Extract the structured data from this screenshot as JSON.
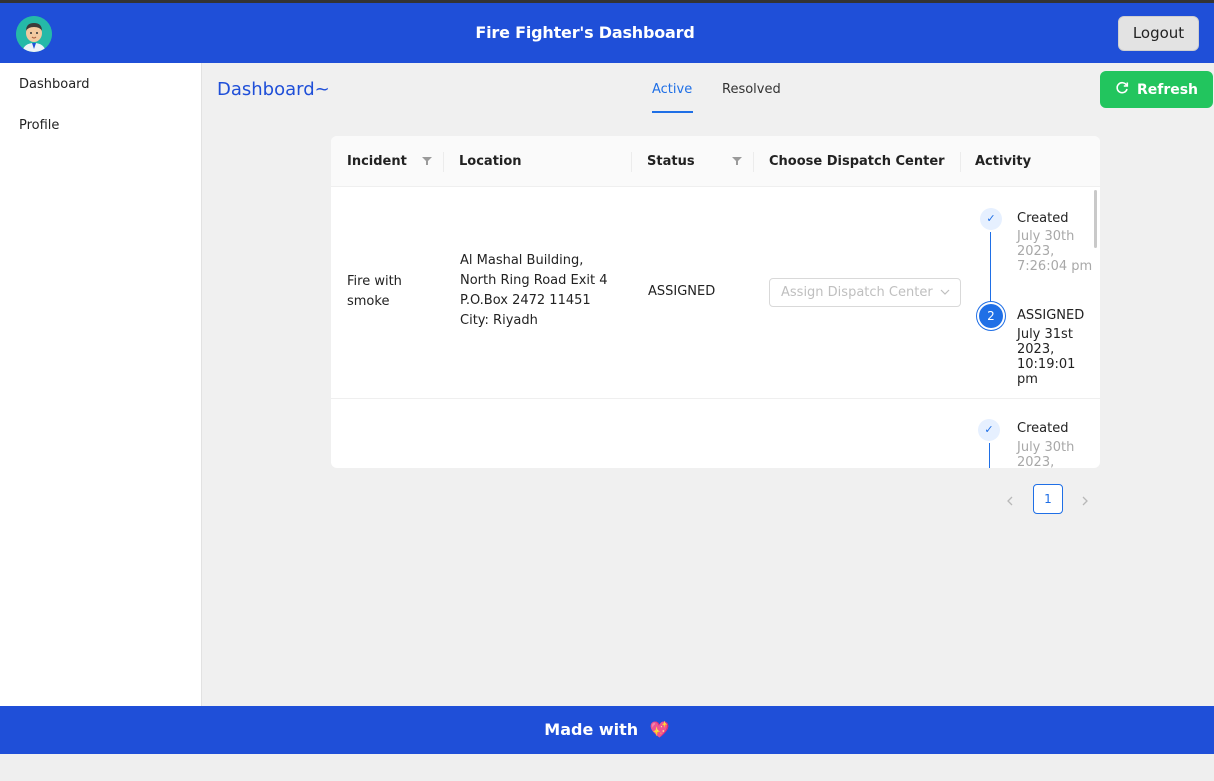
{
  "header": {
    "title": "Fire Fighter's Dashboard",
    "logout_label": "Logout",
    "avatar_icon": "firefighter-avatar-icon"
  },
  "sidebar": {
    "items": [
      {
        "label": "Dashboard"
      },
      {
        "label": "Profile"
      }
    ]
  },
  "main": {
    "title": "Dashboard~",
    "tabs": [
      {
        "label": "Active",
        "active": true
      },
      {
        "label": "Resolved",
        "active": false
      }
    ],
    "refresh_label": "Refresh",
    "refresh_icon": "refresh-icon"
  },
  "table": {
    "columns": [
      "Incident",
      "Location",
      "Status",
      "Choose Dispatch Center",
      "Activity"
    ],
    "rows": [
      {
        "incident": "Fire with smoke",
        "location": "Al Mashal Building, North Ring Road Exit 4 P.O.Box 2472 11451 City: Riyadh",
        "status": "ASSIGNED",
        "dispatch_placeholder": "Assign Dispatch Center",
        "activity": [
          {
            "label": "Created",
            "date": "July 30th 2023, 7:26:04 pm",
            "marker": "check"
          },
          {
            "label": "ASSIGNED",
            "date": "July 31st 2023, 10:19:01 pm",
            "marker": "2"
          }
        ]
      },
      {
        "incident": "",
        "location": "",
        "status": "",
        "activity": [
          {
            "label": "Created",
            "date": "July 30th 2023,",
            "marker": "check"
          }
        ]
      }
    ]
  },
  "pagination": {
    "current_page": "1",
    "prev_icon": "chevron-left-icon",
    "next_icon": "chevron-right-icon"
  },
  "footer": {
    "text": "Made with",
    "heart": "💖"
  },
  "colors": {
    "primary": "#1f4fd8",
    "accent": "#1f6fe6",
    "success": "#22c55e"
  }
}
